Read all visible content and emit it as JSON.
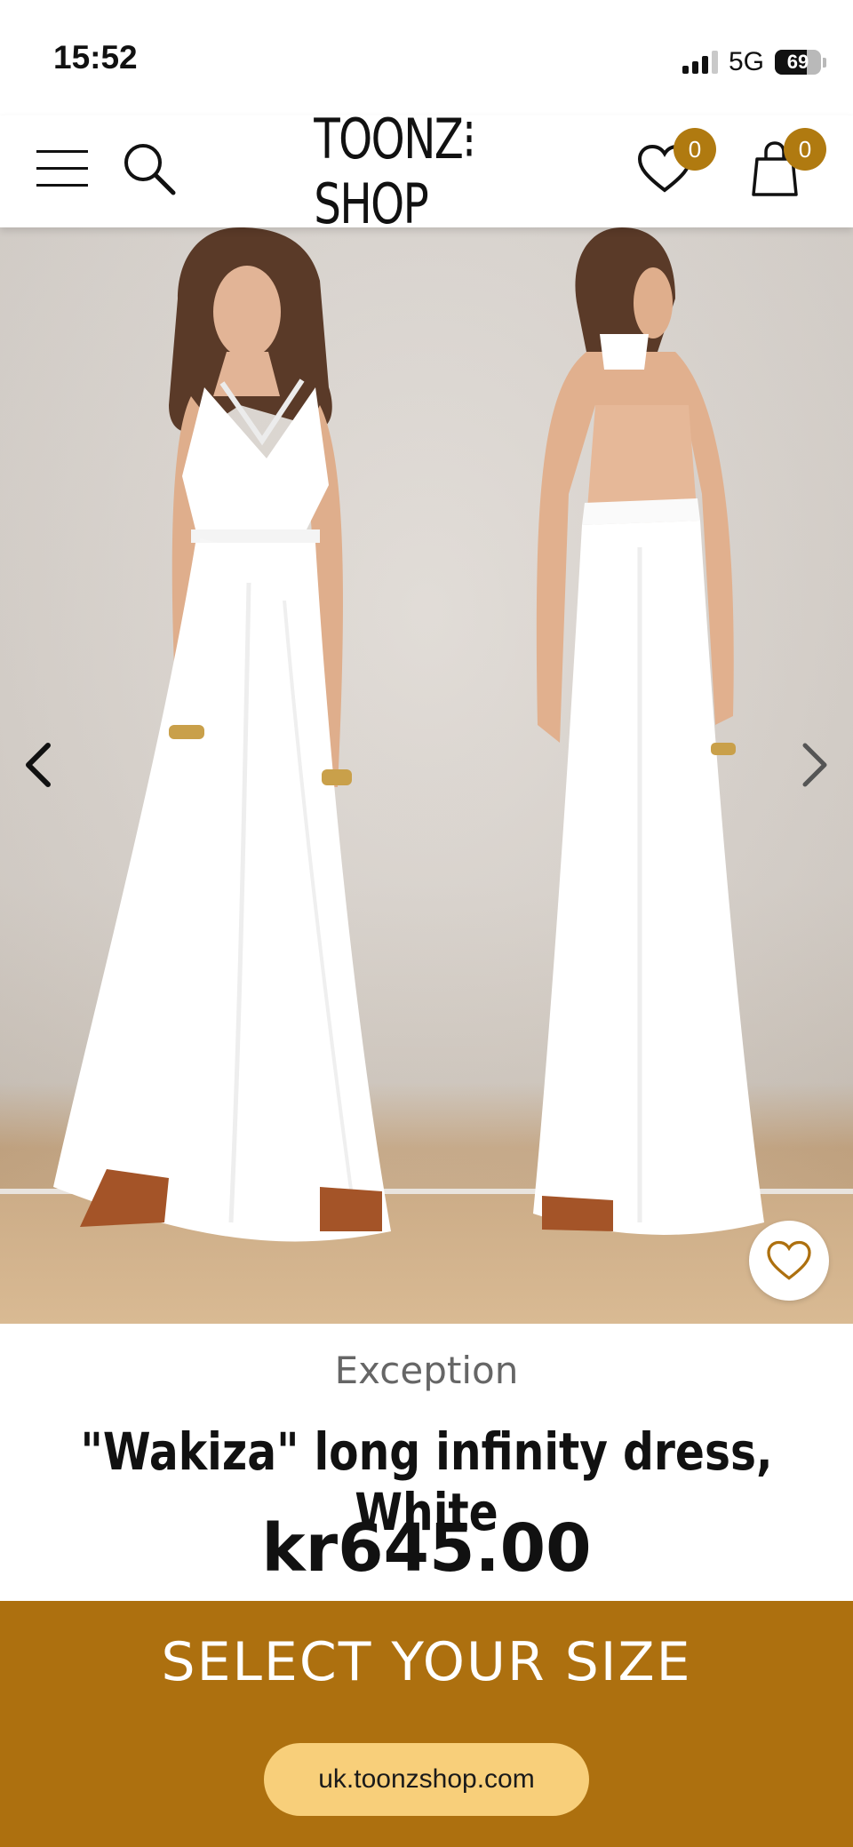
{
  "status_bar": {
    "time": "15:52",
    "network": "5G",
    "battery": "69",
    "battery_level": 0.69
  },
  "header": {
    "logo": "TOONZ⁝SHOP",
    "wishlist_count": "0",
    "cart_count": "0",
    "icons": [
      "menu-icon",
      "search-icon",
      "heart-icon",
      "shopping-bag-icon"
    ]
  },
  "gallery": {
    "prev_icon": "chevron-left-icon",
    "next_icon": "chevron-right-icon",
    "favorite_icon": "heart-icon"
  },
  "product": {
    "brand": "Exception",
    "title": "\"Wakiza\" long infinity dress, White",
    "price": "kr645.00"
  },
  "cta": {
    "label": "SELECT YOUR SIZE",
    "url": "uk.toonzshop.com"
  },
  "colors": {
    "accent": "#ad700f",
    "badge": "#b07a10",
    "pill": "#f8cf7a"
  }
}
